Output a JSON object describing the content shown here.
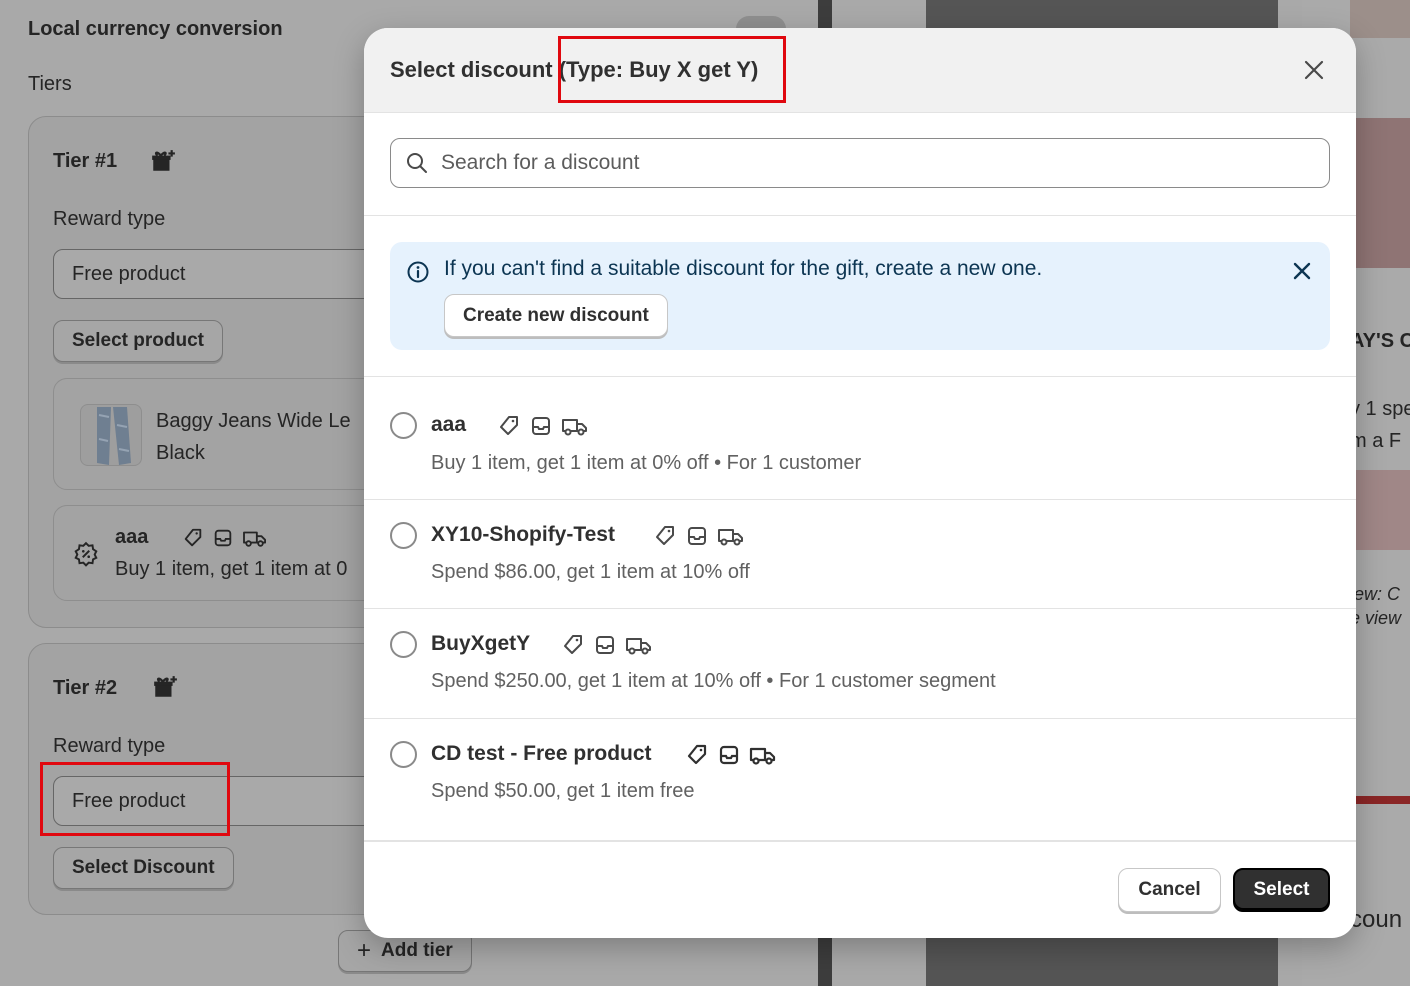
{
  "background": {
    "section_title": "Local currency conversion",
    "tiers_label": "Tiers",
    "tier1": {
      "title": "Tier #1",
      "reward_label": "Reward type",
      "reward_value": "Free product",
      "select_button": "Select product",
      "product_name_line1": "Baggy Jeans Wide Le",
      "product_name_line2": "Black",
      "discount_name": "aaa",
      "discount_desc": "Buy 1 item, get 1 item at 0"
    },
    "tier2": {
      "title": "Tier #2",
      "reward_label": "Reward type",
      "reward_value": "Free product",
      "select_button": "Select Discount"
    },
    "add_tier": "Add tier",
    "right_fragments": {
      "heading": "AY'S C",
      "line1": "y 1 spe",
      "line2": "m a F",
      "view1": "iew: C",
      "view2": "e view",
      "discount_frag": "coun"
    }
  },
  "modal": {
    "title_prefix": "Select discount",
    "title_type": "(Type: Buy X get Y)",
    "search_placeholder": "Search for a discount",
    "banner_text": "If you can't find a suitable discount for the gift, create a new one.",
    "create_button": "Create new discount",
    "discounts": [
      {
        "name": "aaa",
        "description": "Buy 1 item, get 1 item at 0% off • For 1 customer"
      },
      {
        "name": "XY10-Shopify-Test",
        "description": "Spend $86.00, get 1 item at 10% off"
      },
      {
        "name": "BuyXgetY",
        "description": "Spend $250.00, get 1 item at 10% off • For 1 customer segment"
      },
      {
        "name": "CD test - Free product",
        "description": "Spend $50.00, get 1 item free"
      }
    ],
    "cancel_button": "Cancel",
    "select_button": "Select"
  },
  "colors": {
    "highlight": "#e0080f",
    "primary_button": "#303030",
    "banner_bg": "#e6f2fd"
  }
}
